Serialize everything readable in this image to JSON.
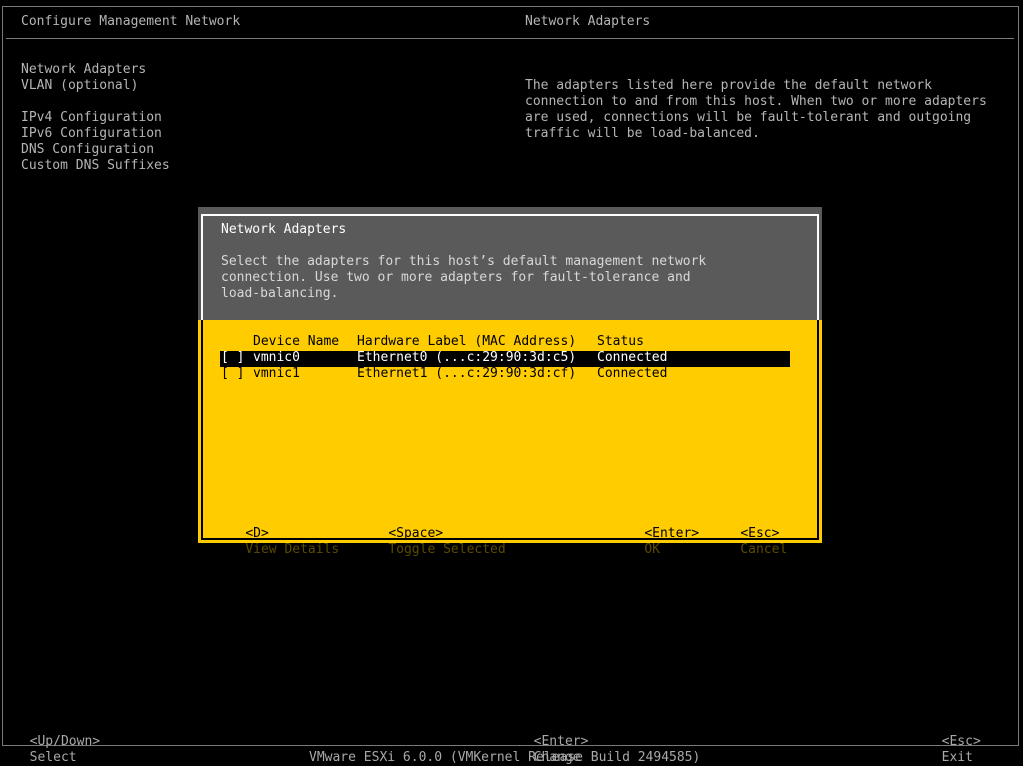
{
  "header": {
    "left_title": "Configure Management Network",
    "right_title": "Network Adapters"
  },
  "menu": {
    "items": [
      "Network Adapters",
      "VLAN (optional)",
      "IPv4 Configuration",
      "IPv6 Configuration",
      "DNS Configuration",
      "Custom DNS Suffixes"
    ]
  },
  "description": {
    "lines": [
      "The adapters listed here provide the default network",
      "connection to and from this host. When two or more adapters",
      "are used, connections will be fault-tolerant and outgoing",
      "traffic will be load-balanced."
    ]
  },
  "dialog": {
    "title": "Network Adapters",
    "desc_lines": [
      "Select the adapters for this host’s default management network",
      "connection. Use two or more adapters for fault-tolerance and",
      "load-balancing."
    ],
    "table": {
      "headers": {
        "device": "Device Name",
        "hw": "Hardware Label (MAC Address)",
        "status": "Status"
      },
      "rows": [
        {
          "check": "[ ]",
          "device": "vmnic0",
          "hw": "Ethernet0 (...c:29:90:3d:c5)",
          "status": "Connected"
        },
        {
          "check": "[ ]",
          "device": "vmnic1",
          "hw": "Ethernet1 (...c:29:90:3d:cf)",
          "status": "Connected"
        }
      ]
    },
    "footer": {
      "details_key": "<D>",
      "details_label": "View Details",
      "toggle_key": "<Space>",
      "toggle_label": "Toggle Selected",
      "ok_key": "<Enter>",
      "ok_label": "OK",
      "cancel_key": "<Esc>",
      "cancel_label": "Cancel"
    }
  },
  "footer": {
    "select_key": "<Up/Down>",
    "select_label": "Select",
    "change_key": "<Enter>",
    "change_label": "Change",
    "exit_key": "<Esc>",
    "exit_label": "Exit"
  },
  "status_bar": {
    "text": "VMware ESXi 6.0.0 (VMKernel Release Build 2494585)"
  },
  "colors": {
    "background": "#000000",
    "dialog_yellow": "#ffcc00",
    "dialog_grey": "#5a5a5a",
    "text_grey": "#b5b5b5"
  }
}
